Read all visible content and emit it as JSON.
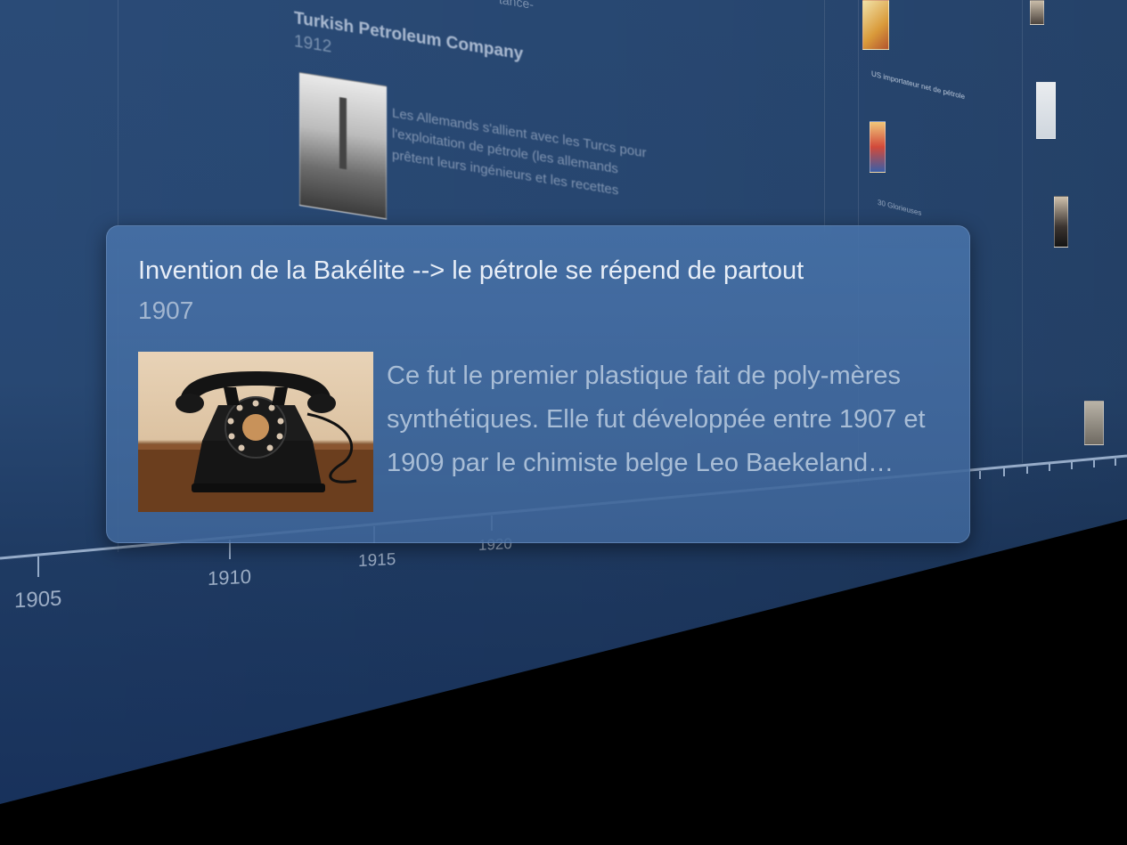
{
  "background_event": {
    "title": "Turkish Petroleum Company",
    "year": "1912",
    "description": "Les Allemands s'allient avec les Turcs pour l'exploitation de pétrole (les allemands prêtent leurs ingénieurs et les recettes",
    "top_text": "tance-"
  },
  "popup": {
    "title": "Invention de la Bakélite --> le pétrole se répend de partout",
    "year": "1907",
    "image_icon": "rotary-telephone-photo",
    "description": "Ce fut le premier plastique fait de poly-mères synthétiques. Elle fut développée entre 1907 et 1909 par le chimiste belge Leo Baekeland…"
  },
  "timeline": {
    "tick_labels": [
      "1905",
      "1910",
      "1915",
      "1920"
    ]
  },
  "far_events": [
    {
      "title": "US importateur net de pétrole"
    },
    {
      "title": "30 Glorieuses"
    }
  ],
  "colors": {
    "wall": "#284873",
    "popup": "#4670a6",
    "title_text": "#e8eef7",
    "secondary_text": "#a2b6d0"
  }
}
